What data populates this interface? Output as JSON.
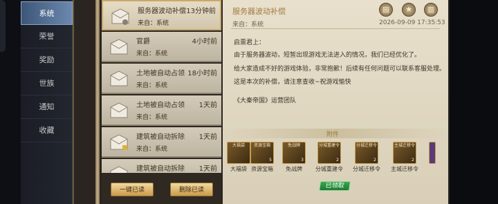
{
  "nav": {
    "items": [
      {
        "label": "系统",
        "active": true
      },
      {
        "label": "荣誉",
        "active": false
      },
      {
        "label": "奖励",
        "active": false
      },
      {
        "label": "世族",
        "active": false
      },
      {
        "label": "通知",
        "active": false
      },
      {
        "label": "收藏",
        "active": false
      }
    ]
  },
  "mails": [
    {
      "title": "服务器波动补偿",
      "time": "13分钟前",
      "from": "来自：系统",
      "selected": true
    },
    {
      "title": "官爵",
      "time": "4小时前",
      "from": "来自：系统",
      "selected": false
    },
    {
      "title": "土地被自动占领",
      "time": "18小时前",
      "from": "来自：系统",
      "selected": false
    },
    {
      "title": "土地被自动占领",
      "time": "1天前",
      "from": "来自：系统",
      "selected": false
    },
    {
      "title": "建筑被自动拆除",
      "time": "1天前",
      "from": "来自：系统",
      "selected": false
    },
    {
      "title": "建筑被自动拆除",
      "time": "1天前",
      "from": "",
      "selected": false
    }
  ],
  "buttons": {
    "read_all": "一键已读",
    "delete_read": "删除已读"
  },
  "detail": {
    "title": "服务器波动补偿",
    "from": "来自：系统",
    "date": "2026-09-09 17:35:53",
    "greeting": "启禀君上：",
    "line1": "由于服务器波动，短暂出现游戏无法进入的情况，我们已经优化了。",
    "line2": "给大家造成不好的游戏体验，非常抱歉！后续有任何问题可以联系客服处理。",
    "line3": "这是本次的补偿，请注意查收~祝游戏愉快",
    "signature": "《大秦帝国》运营团队",
    "attachments_label": "附件",
    "claimed_badge": "已领取"
  },
  "attachments": [
    {
      "tag": "大福袋",
      "count": "",
      "name": "大福袋"
    },
    {
      "tag": "资源宝箱",
      "count": "5",
      "name": "资源宝箱"
    },
    {
      "tag": "免战牌",
      "count": "3",
      "name": "免战牌"
    },
    {
      "tag": "分城重建令",
      "count": "2",
      "name": "分城重建令"
    },
    {
      "tag": "分城迁移令",
      "count": "2",
      "name": "分城迁移令"
    },
    {
      "tag": "主城迁移令",
      "count": "2",
      "name": "主城迁移令"
    }
  ],
  "icons": [
    "note-icon",
    "star-icon",
    "trash-icon",
    "mail-envelope-icon"
  ],
  "colors": {
    "accent": "#a17a3f",
    "claimed": "#2e9444",
    "nav_active": "#5a76a0"
  }
}
